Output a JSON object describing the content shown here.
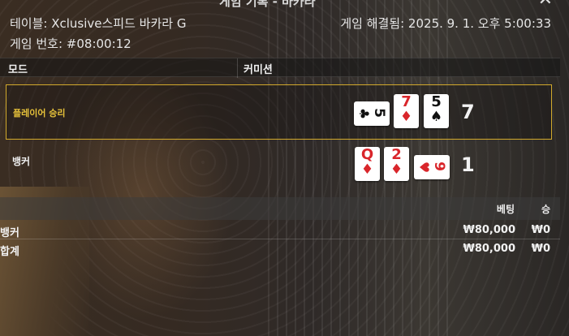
{
  "window": {
    "title": "게임 기록 - 바카라",
    "close_symbol": "✕"
  },
  "info": {
    "table": "테이블: Xclusive스피드 바카라 G",
    "resolved": "게임 해결됨: 2025. 9. 1. 오후 5:00:33",
    "game_number": "게임 번호: #08:00:12"
  },
  "mode_header": {
    "mode_label": "모드",
    "commission_label": "커미션"
  },
  "hands": {
    "player": {
      "label": "플레이어 승리",
      "score": "7",
      "highlight_color": "#d2a92c",
      "cards": [
        {
          "rank": "5",
          "suit": "♣",
          "suit_name": "clubs",
          "orientation": "horizontal"
        },
        {
          "rank": "7",
          "suit": "♦",
          "suit_name": "diamonds",
          "orientation": "vertical"
        },
        {
          "rank": "5",
          "suit": "♠",
          "suit_name": "spades",
          "orientation": "vertical"
        }
      ]
    },
    "banker": {
      "label": "뱅커",
      "score": "1",
      "cards": [
        {
          "rank": "Q",
          "suit": "♦",
          "suit_name": "diamonds",
          "orientation": "vertical"
        },
        {
          "rank": "2",
          "suit": "♦",
          "suit_name": "diamonds",
          "orientation": "vertical"
        },
        {
          "rank": "9",
          "suit": "♥",
          "suit_name": "hearts",
          "orientation": "horizontal"
        }
      ]
    }
  },
  "bets": {
    "headers": {
      "bet": "베팅",
      "win": "승"
    },
    "rows": [
      {
        "label": "뱅커",
        "amount": "₩80,000",
        "win": "₩0"
      },
      {
        "label": "합계",
        "amount": "₩80,000",
        "win": "₩0"
      }
    ]
  }
}
